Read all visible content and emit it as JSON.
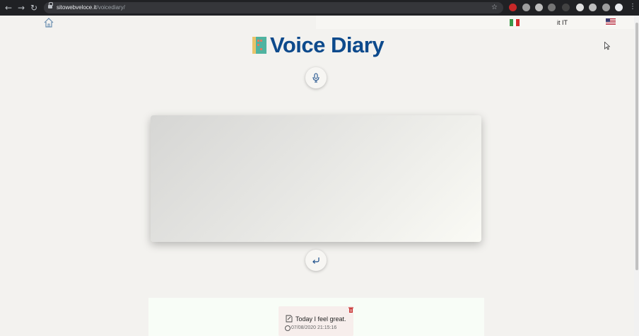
{
  "browser": {
    "url_host": "sitowebveloce.it",
    "url_path": "/voicediary/",
    "back_icon": "arrow-left-icon",
    "forward_icon": "arrow-right-icon",
    "reload_icon": "reload-icon",
    "bookmark_icon": "star-icon",
    "menu_icon": "kebab-menu-icon"
  },
  "header": {
    "home_icon": "home-icon",
    "language_label": "it IT",
    "flag_left": "italy-flag-icon",
    "flag_right": "usa-flag-icon"
  },
  "app": {
    "title": "Voice Diary",
    "logo_icon": "book-icon",
    "title_color": "#0d4a8c",
    "mic_icon": "microphone-icon",
    "undo_icon": "undo-arrow-icon",
    "transcript_text": ""
  },
  "entries": [
    {
      "text": "Today I feel great.",
      "date": "07/08/2020 21:15:16"
    }
  ]
}
